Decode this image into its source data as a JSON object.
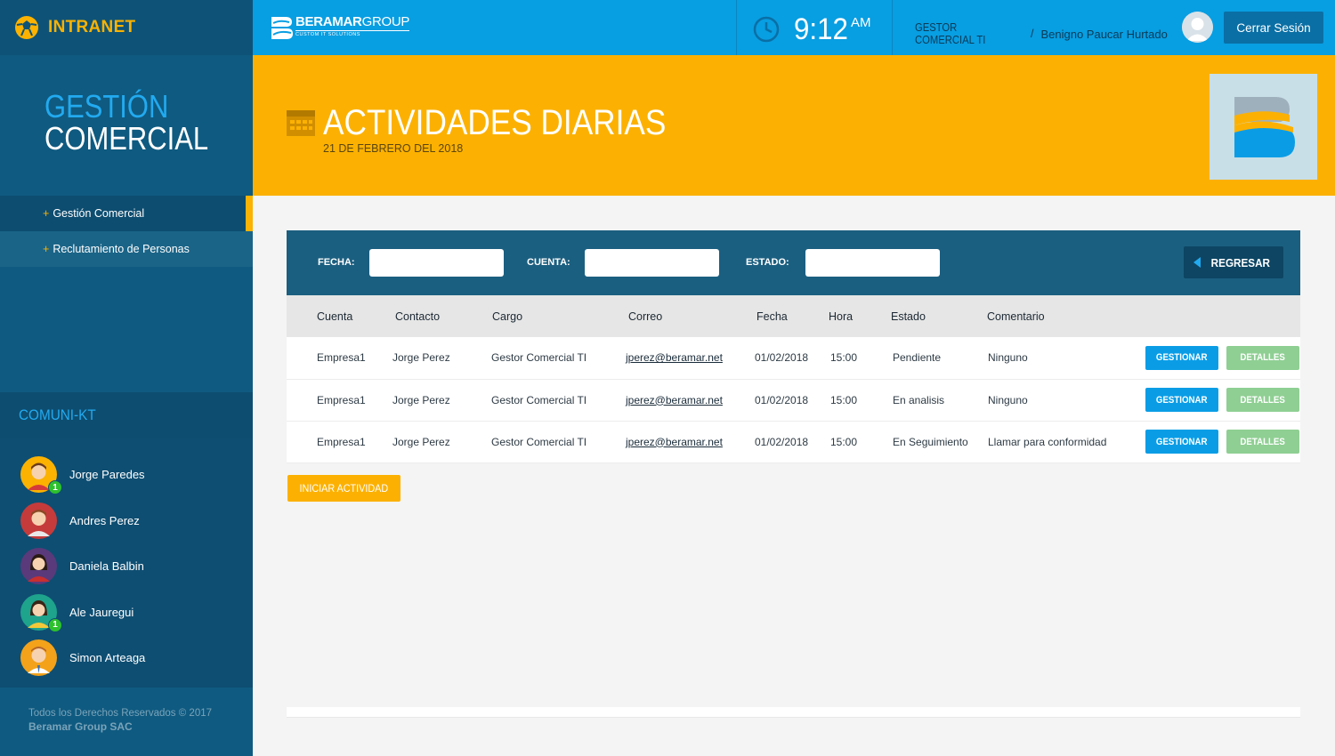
{
  "app": {
    "brand": "INTRANET"
  },
  "sidebar": {
    "section_title_1": "GESTIÓN",
    "section_title_2": "COMERCIAL",
    "menu": [
      {
        "label": "Gestión Comercial"
      },
      {
        "label": "Reclutamiento de Personas"
      }
    ],
    "comuni_title": "COMUNI-KT",
    "contacts": [
      {
        "name": "Jorge Paredes",
        "badge": "1"
      },
      {
        "name": "Andres Perez"
      },
      {
        "name": "Daniela Balbin"
      },
      {
        "name": "Ale Jauregui",
        "badge": "1"
      },
      {
        "name": "Simon Arteaga"
      }
    ],
    "footer_line1": "Todos los Derechos Reservados © 2017",
    "footer_line2": "Beramar Group SAC"
  },
  "topbar": {
    "logo_bold": "BERAMAR",
    "logo_light": "GROUP",
    "logo_tagline": "CUSTOM IT SOLUTIONS",
    "time": "9:12",
    "ampm": "AM",
    "role": "GESTOR COMERCIAL TI",
    "separator": "/",
    "user_name": "Benigno Paucar Hurtado",
    "logout_label": "Cerrar Sesión"
  },
  "header": {
    "title": "ACTIVIDADES DIARIAS",
    "subtitle": "21 DE FEBRERO DEL 2018"
  },
  "filters": {
    "fecha_label": "FECHA:",
    "cuenta_label": "CUENTA:",
    "estado_label": "ESTADO:",
    "fecha_value": "",
    "cuenta_value": "",
    "estado_value": "",
    "back_label": "REGRESAR"
  },
  "table": {
    "columns": [
      "Cuenta",
      "Contacto",
      "Cargo",
      "Correo",
      "Fecha",
      "Hora",
      "Estado",
      "Comentario"
    ],
    "rows": [
      {
        "cuenta": "Empresa1",
        "contacto": "Jorge Perez",
        "cargo": "Gestor Comercial TI",
        "correo": "jperez@beramar.net",
        "fecha": "01/02/2018",
        "hora": "15:00",
        "estado": "Pendiente",
        "comentario": "Ninguno"
      },
      {
        "cuenta": "Empresa1",
        "contacto": "Jorge Perez",
        "cargo": "Gestor Comercial TI",
        "correo": "jperez@beramar.net",
        "fecha": "01/02/2018",
        "hora": "15:00",
        "estado": "En analisis",
        "comentario": "Ninguno"
      },
      {
        "cuenta": "Empresa1",
        "contacto": "Jorge Perez",
        "cargo": "Gestor Comercial TI",
        "correo": "jperez@beramar.net",
        "fecha": "01/02/2018",
        "hora": "15:00",
        "estado": "En Seguimiento",
        "comentario": "Llamar para conformidad"
      }
    ],
    "gestionar_label": "GESTIONAR",
    "detalles_label": "DETALLES"
  },
  "actions": {
    "start_label": "INICIAR ACTIVIDAD"
  },
  "colors": {
    "sidebar": "#0f5a80",
    "topbar": "#089ee2",
    "accent_orange": "#fcb102",
    "accent_blue": "#22aaf0",
    "button_green": "#8fcf93"
  }
}
